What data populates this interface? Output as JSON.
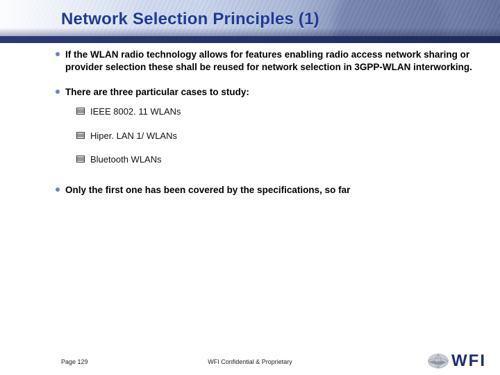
{
  "title": "Network Selection Principles (1)",
  "bullets": [
    {
      "text": "If the WLAN radio technology allows for features enabling radio access network sharing or provider selection these shall be reused for network selection in 3GPP-WLAN interworking."
    },
    {
      "text": "There are three particular cases to study:",
      "children": [
        {
          "text": "IEEE 8002. 11 WLANs"
        },
        {
          "text": "Hiper. LAN 1/ WLANs"
        },
        {
          "text": "Bluetooth WLANs"
        }
      ]
    },
    {
      "text": "Only the first one has been covered by the specifications, so far"
    }
  ],
  "footer": {
    "page": "Page 129",
    "confidential": "WFI Confidential & Proprietary",
    "logo_text": "WFI"
  }
}
